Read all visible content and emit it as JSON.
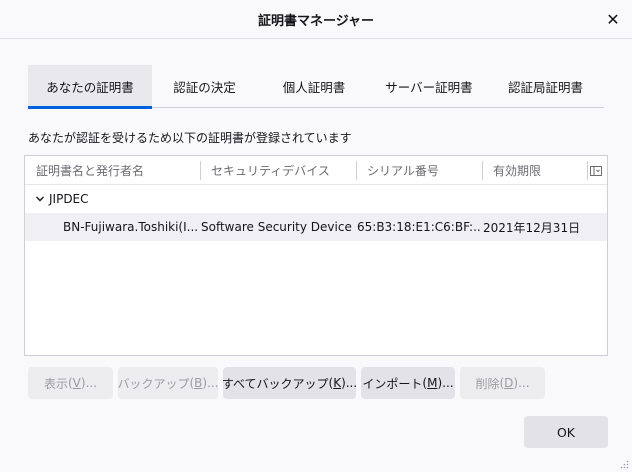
{
  "dialog": {
    "title": "証明書マネージャー",
    "close_glyph": "✕"
  },
  "tabs": [
    {
      "label": "あなたの証明書",
      "active": true
    },
    {
      "label": "認証の決定",
      "active": false
    },
    {
      "label": "個人証明書",
      "active": false
    },
    {
      "label": "サーバー証明書",
      "active": false
    },
    {
      "label": "認証局証明書",
      "active": false
    }
  ],
  "description": "あなたが認証を受けるため以下の証明書が登録されています",
  "table": {
    "columns": [
      "証明書名と発行者名",
      "セキュリティデバイス",
      "シリアル番号",
      "有効期限"
    ],
    "groups": [
      {
        "name": "JIPDEC",
        "expanded": true,
        "rows": [
          {
            "name": "BN-Fujiwara.Toshiki(I...",
            "device": "Software Security Device",
            "serial": "65:B3:18:E1:C6:BF:...",
            "expires": "2021年12月31日"
          }
        ]
      }
    ]
  },
  "buttons": {
    "view": {
      "label": "表示",
      "key": "V",
      "enabled": false
    },
    "backup": {
      "label": "バックアップ",
      "key": "B",
      "enabled": false
    },
    "backup_all": {
      "label": "すべてバックアップ",
      "key": "K",
      "enabled": true
    },
    "import": {
      "label": "インポート",
      "key": "M",
      "enabled": true
    },
    "delete": {
      "label": "削除",
      "key": "D",
      "enabled": false
    },
    "ok": "OK"
  },
  "colors": {
    "accent": "#0061e0",
    "disabled_text": "#9b9ba2"
  },
  "icons": [
    "close-icon",
    "chevron-down-icon",
    "column-picker-icon",
    "resize-grip-icon"
  ]
}
